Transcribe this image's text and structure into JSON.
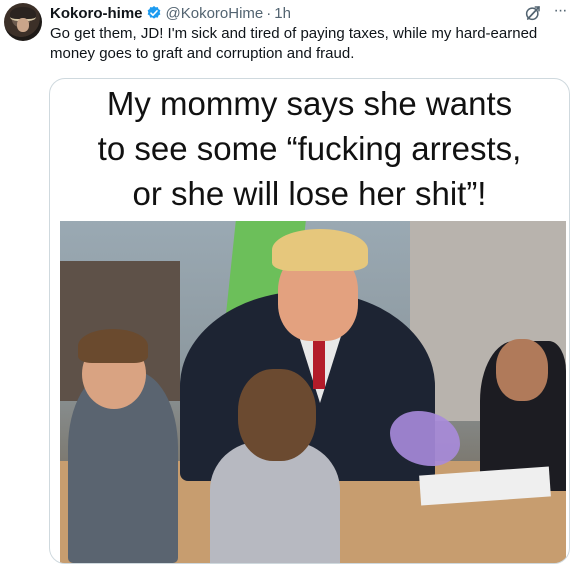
{
  "author": {
    "name": "Kokoro-hime",
    "handle": "@KokoroHime",
    "separator": "·",
    "time": "1h",
    "avatar_icon": "avatar-photo",
    "verified_icon": "verified-badge-icon",
    "verified_color": "#1d9bf0"
  },
  "tweet": {
    "text_line1": "Go get them, JD!  I'm sick and tired of paying taxes, while my hard-earned",
    "text_line2": "money goes to graft and corruption and fraud."
  },
  "media": {
    "caption_line1": "My mommy says she wants",
    "caption_line2": "to see some “fucking arrests,",
    "caption_line3": "or she will lose her shit”!"
  },
  "actions": {
    "grok_icon": "grok-icon",
    "more_label": "···"
  },
  "colors": {
    "text": "#0f1419",
    "secondary": "#536471",
    "border": "#cfd9de"
  }
}
